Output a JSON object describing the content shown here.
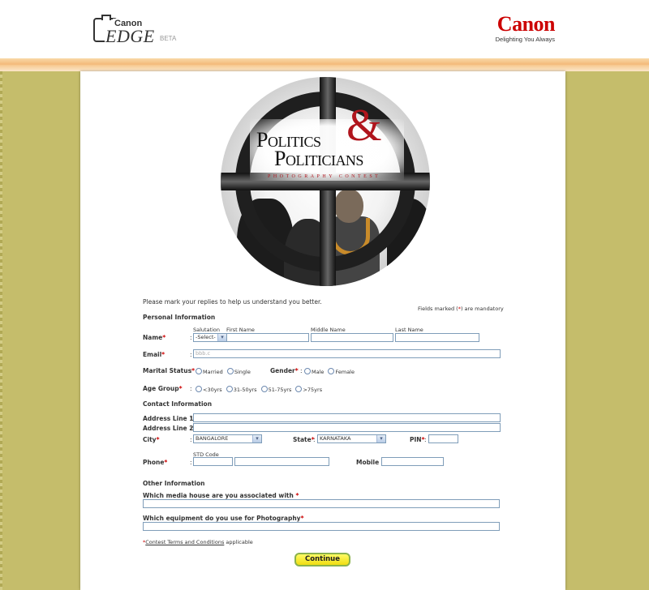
{
  "header": {
    "edge_logo_brand": "Canon",
    "edge_logo_word": "EDGE",
    "edge_logo_badge": "BETA",
    "canon_logo": "Canon",
    "canon_tagline": "Delighting You Always"
  },
  "banner": {
    "title_line1": "Politics",
    "ampersand": "&",
    "title_line2": "Politicians",
    "subtitle": "PHOTOGRAPHY CONTEST"
  },
  "form": {
    "intro": "Please mark your replies to help us understand you better.",
    "mandatory_note_before": "Fields marked (",
    "mandatory_note_mark": "*",
    "mandatory_note_after": ") are mandatory",
    "sections": {
      "personal": "Personal Information",
      "contact": "Contact Information",
      "other": "Other Information"
    },
    "name": {
      "label": "Name",
      "salutation_header": "Salutation",
      "first_header": "First Name",
      "middle_header": "Middle Name",
      "last_header": "Last Name",
      "salutation_value": "-Select-",
      "first_value": "",
      "middle_value": "",
      "last_value": ""
    },
    "email": {
      "label": "Email",
      "placeholder": "bbb.c"
    },
    "marital": {
      "label": "Marital Status",
      "options": [
        "Married",
        "Single"
      ]
    },
    "gender": {
      "label": "Gender",
      "options": [
        "Male",
        "Female"
      ]
    },
    "age_group": {
      "label": "Age Group",
      "options": [
        "<30yrs",
        "31-50yrs",
        "51-75yrs",
        ">75yrs"
      ]
    },
    "address1": {
      "label": "Address Line 1",
      "value": ""
    },
    "address2": {
      "label": "Address Line 2",
      "value": ""
    },
    "city": {
      "label": "City",
      "value": "BANGALORE"
    },
    "state": {
      "label": "State",
      "value": "KARNATAKA"
    },
    "pin": {
      "label": "PIN",
      "value": ""
    },
    "phone": {
      "label": "Phone",
      "std_header": "STD Code",
      "std_value": "",
      "number_value": ""
    },
    "mobile": {
      "label": "Mobile :",
      "value": ""
    },
    "media_house": {
      "label": "Which media house are you associated with",
      "value": ""
    },
    "equipment": {
      "label": "Which equipment do you use for Photography",
      "value": ""
    },
    "terms": {
      "prefix": "*",
      "link": "Contest Terms and Conditions",
      "suffix": " applicable"
    },
    "required_mark": "*",
    "colon": ":",
    "continue_label": "Continue"
  },
  "colors": {
    "brand_red": "#cc0000",
    "olive_background": "#c5bd6b",
    "orange_band": "#f4ba7a",
    "button_yellow": "#f5e82a"
  }
}
